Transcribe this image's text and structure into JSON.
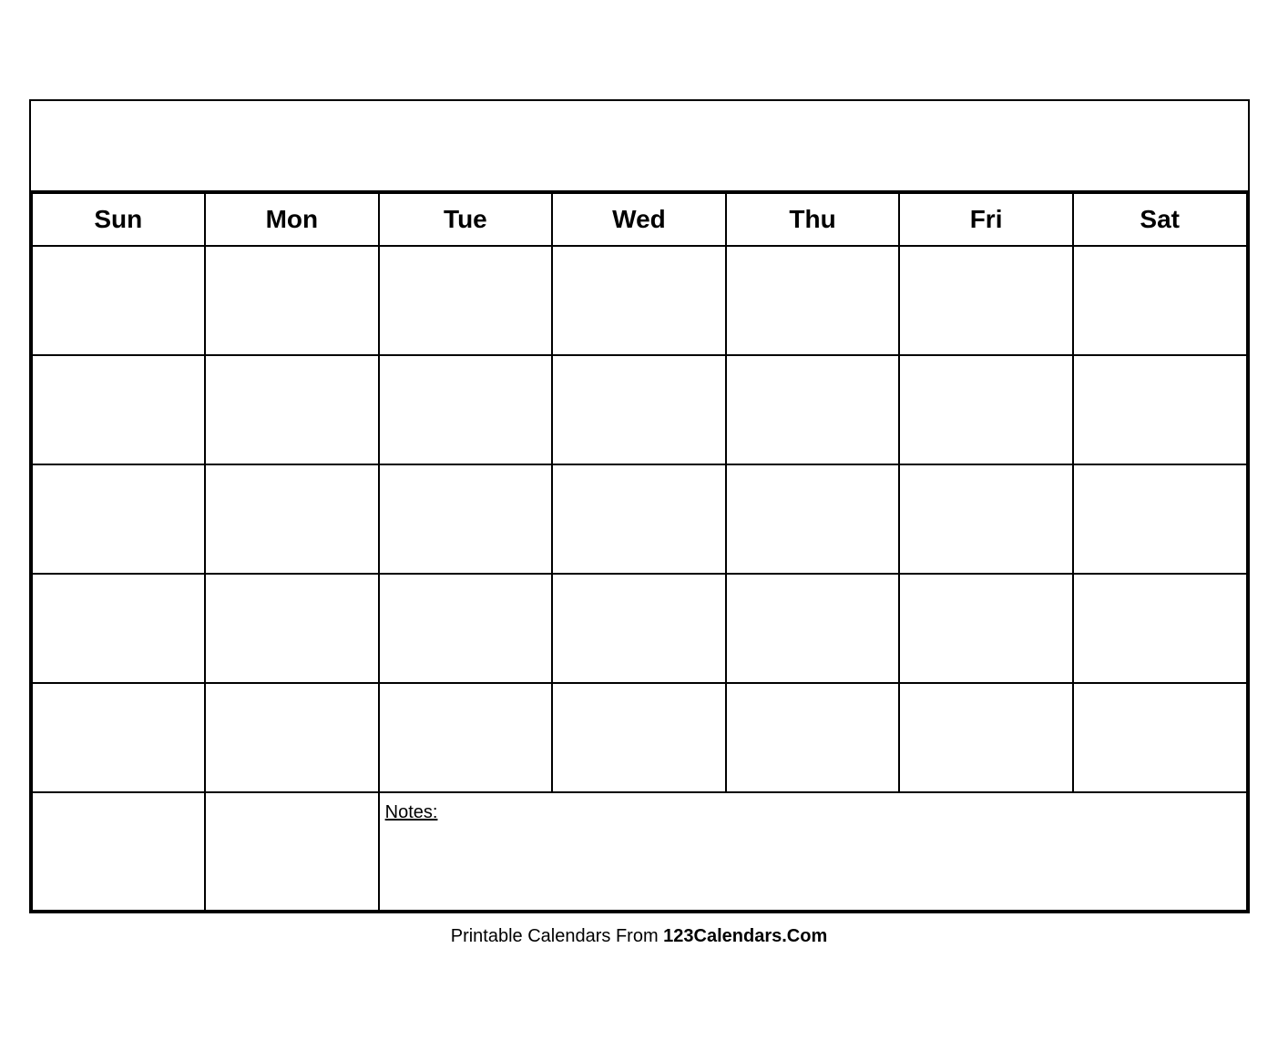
{
  "calendar": {
    "title": "",
    "days": [
      "Sun",
      "Mon",
      "Tue",
      "Wed",
      "Thu",
      "Fri",
      "Sat"
    ],
    "rows": 5,
    "notes_label": "Notes:",
    "notes_colspan": 5
  },
  "footer": {
    "text_normal": "Printable Calendars From ",
    "text_bold": "123Calendars.Com"
  }
}
